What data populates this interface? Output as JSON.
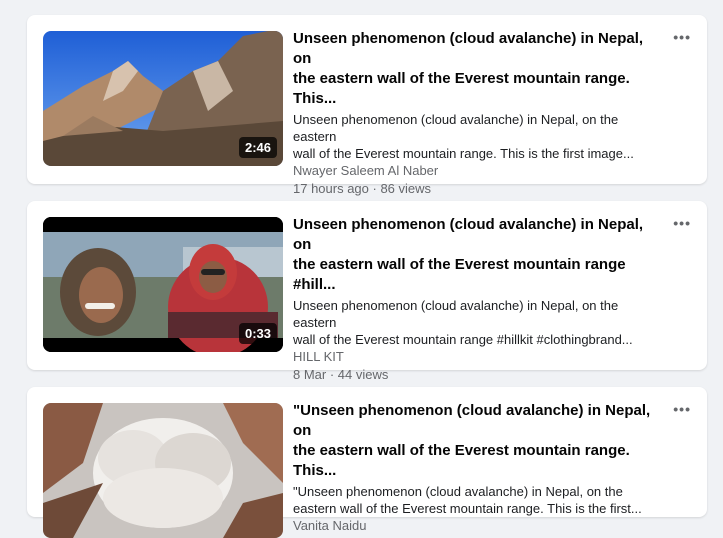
{
  "posts": [
    {
      "title_line1": "Unseen phenomenon (cloud avalanche) in Nepal, on",
      "title_line2": "the eastern wall of the Everest mountain range. This...",
      "desc_line1": "Unseen phenomenon (cloud avalanche) in Nepal, on the eastern",
      "desc_line2": "wall of the Everest mountain range. This is the first image...",
      "author": "Nwayer Saleem Al Naber",
      "stats": "17 hours ago · 86 views",
      "duration": "2:46",
      "more": "•••"
    },
    {
      "title_line1": "Unseen phenomenon (cloud avalanche) in Nepal, on",
      "title_line2": "the eastern wall of the Everest mountain range #hill...",
      "desc_line1": "Unseen phenomenon (cloud avalanche) in Nepal, on the eastern",
      "desc_line2": "wall of the Everest mountain range #hillkit #clothingbrand...",
      "author": "HILL KIT",
      "stats": "8 Mar · 44 views",
      "duration": "0:33",
      "more": "•••"
    },
    {
      "title_line1": "\"Unseen phenomenon (cloud avalanche) in Nepal, on",
      "title_line2": "the eastern wall of the Everest mountain range. This...",
      "desc_line1": "\"Unseen phenomenon (cloud avalanche) in Nepal, on the",
      "desc_line2": "eastern wall of the Everest mountain range. This is the first...",
      "author": "Vanita Naidu",
      "stats": "",
      "duration": "",
      "more": "•••"
    }
  ]
}
